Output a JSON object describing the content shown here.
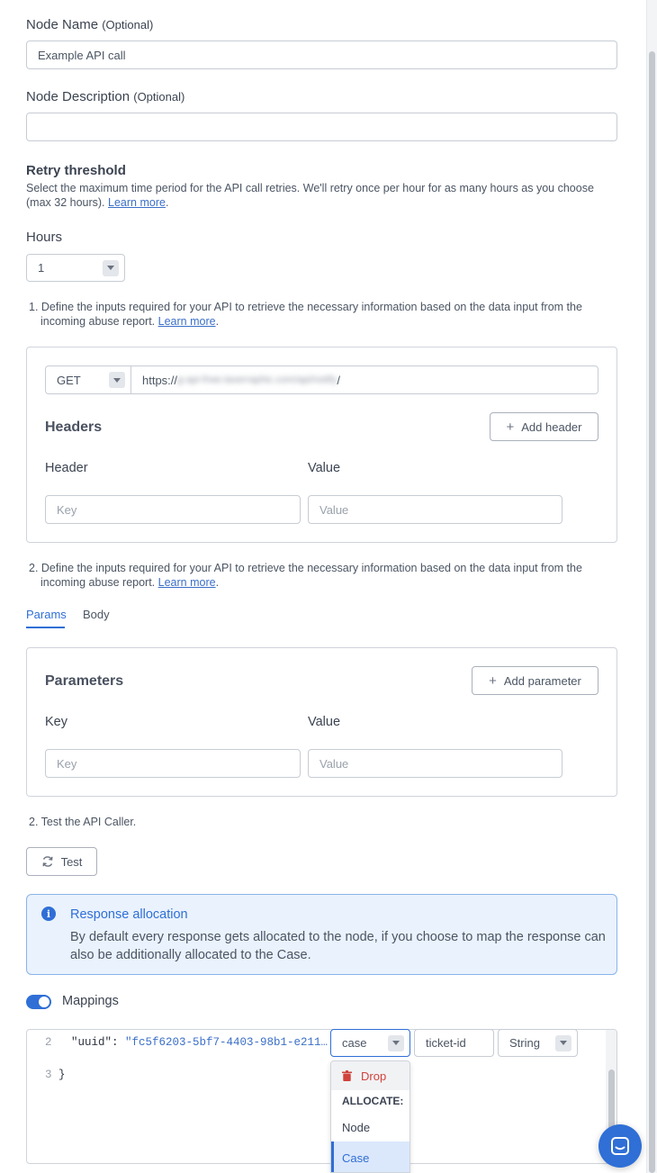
{
  "node_name": {
    "label": "Node Name",
    "optional": "(Optional)",
    "value": "Example API call"
  },
  "node_description": {
    "label": "Node Description",
    "optional": "(Optional)",
    "value": ""
  },
  "retry": {
    "title": "Retry threshold",
    "description": "Select the maximum time period for the API call retries. We'll retry once per hour for as many hours as you choose (max 32 hours).",
    "learn_more": "Learn more",
    "suffix": "."
  },
  "hours": {
    "label": "Hours",
    "value": "1"
  },
  "step1": {
    "text": "1. Define the inputs required for your API to retrieve the necessary information based on the data input from the incoming abuse report.",
    "learn_more": "Learn more",
    "suffix": "."
  },
  "request": {
    "method": "GET",
    "url_prefix": "https://",
    "url_blurred": "g-api-frwe.taxerraphic.com/api/notify",
    "url_suffix": "/"
  },
  "headers": {
    "title": "Headers",
    "add_label": "Add header",
    "col_key": "Header",
    "col_value": "Value",
    "key_placeholder": "Key",
    "value_placeholder": "Value"
  },
  "step2": {
    "text": "2. Define the inputs required for your API to retrieve the necessary information based on the data input from the incoming abuse report.",
    "learn_more": "Learn more",
    "suffix": "."
  },
  "tabs": {
    "params": "Params",
    "body": "Body",
    "active": "params"
  },
  "parameters": {
    "title": "Parameters",
    "add_label": "Add parameter",
    "col_key": "Key",
    "col_value": "Value",
    "key_placeholder": "Key",
    "value_placeholder": "Value"
  },
  "test": {
    "step": "2. Test the API Caller.",
    "button": "Test"
  },
  "response_allocation": {
    "title": "Response allocation",
    "text": "By default every response gets allocated to the node, if you choose to map the response can also be additionally allocated to the Case."
  },
  "mappings": {
    "label": "Mappings",
    "enabled": true
  },
  "code": {
    "line2_num": "2",
    "line2_key": "\"uuid\": ",
    "line2_value": "\"fc5f6203-5bf7-4403-98b1-e211…",
    "line3_num": "3",
    "line3_text": "}"
  },
  "mapping_row": {
    "target": "case",
    "field": "ticket-id",
    "type": "String"
  },
  "dropdown": {
    "drop": "Drop",
    "section": "ALLOCATE:",
    "node": "Node",
    "case": "Case"
  },
  "colors": {
    "accent": "#2f6fd6",
    "link": "#3b6fc7",
    "danger": "#d0423b",
    "info_bg": "#eaf2fd"
  }
}
